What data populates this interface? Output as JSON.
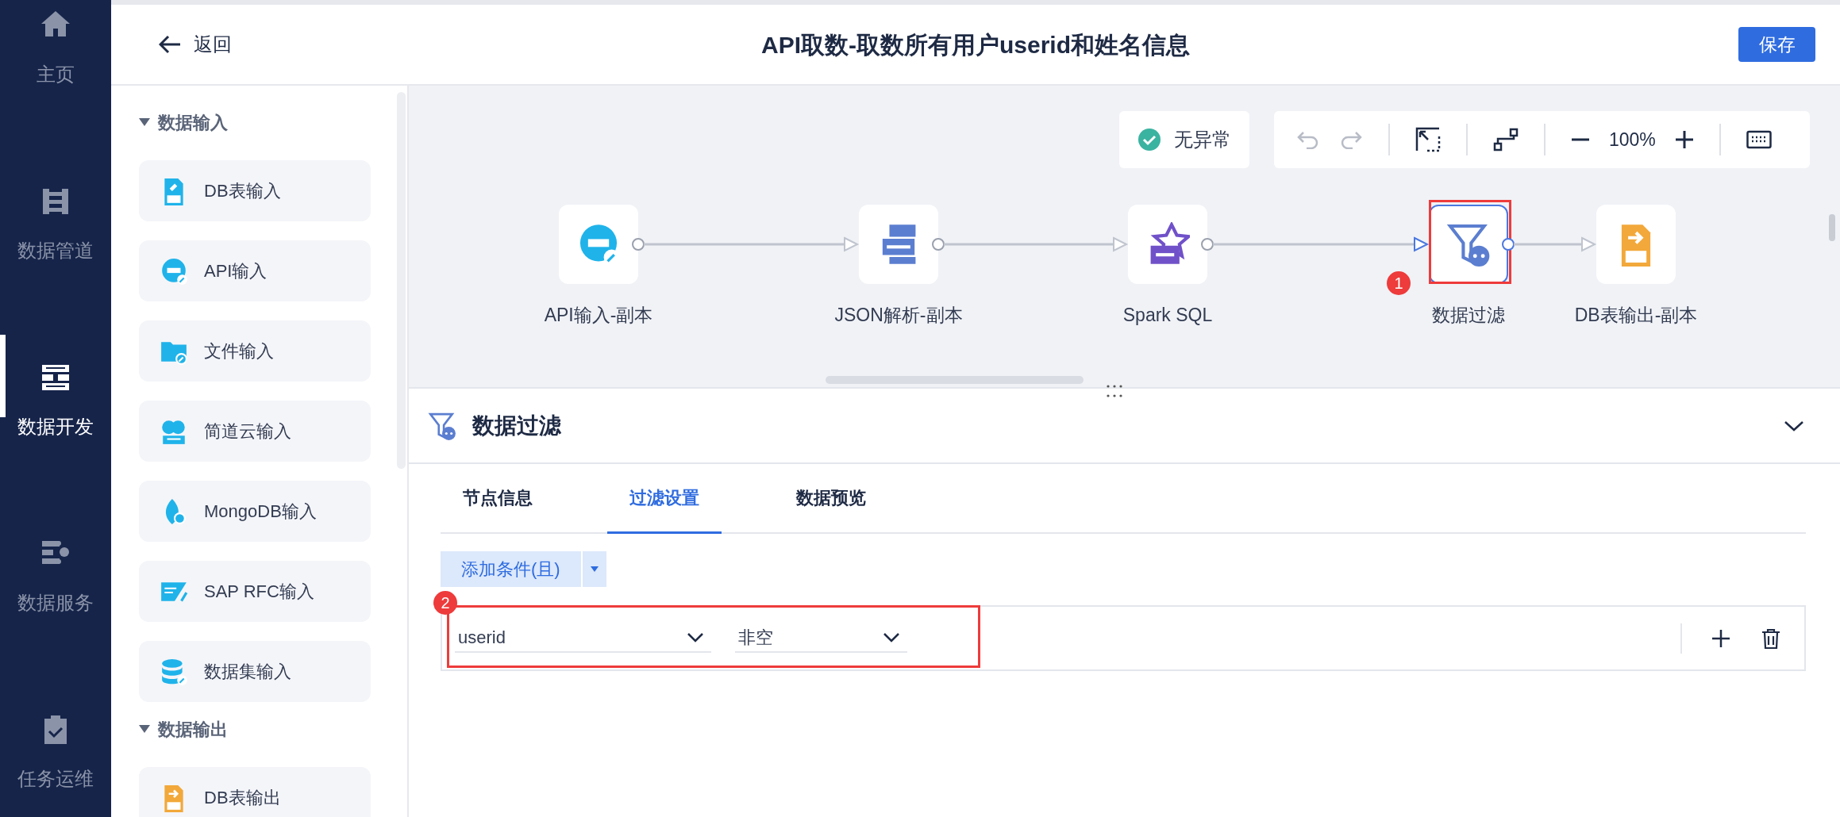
{
  "nav": [
    {
      "label": "主页",
      "kind": "home",
      "selected": false
    },
    {
      "label": "数据管道",
      "kind": "pipeline",
      "selected": false
    },
    {
      "label": "数据开发",
      "kind": "develop",
      "selected": true
    },
    {
      "label": "数据服务",
      "kind": "service",
      "selected": false
    },
    {
      "label": "任务运维",
      "kind": "ops",
      "selected": false
    }
  ],
  "header": {
    "back": "返回",
    "title": "API取数-取数所有用户userid和姓名信息",
    "save": "保存"
  },
  "palette": {
    "sections": [
      {
        "title": "数据输入",
        "expanded": true,
        "items": [
          {
            "label": "DB表输入",
            "kind": "db-in"
          },
          {
            "label": "API输入",
            "kind": "api"
          },
          {
            "label": "文件输入",
            "kind": "file"
          },
          {
            "label": "简道云输入",
            "kind": "jdy"
          },
          {
            "label": "MongoDB输入",
            "kind": "mongo"
          },
          {
            "label": "SAP RFC输入",
            "kind": "sap"
          },
          {
            "label": "数据集输入",
            "kind": "dataset"
          }
        ]
      },
      {
        "title": "数据输出",
        "expanded": true,
        "items": [
          {
            "label": "DB表输出",
            "kind": "db-out"
          }
        ]
      }
    ]
  },
  "canvas": {
    "status": "无异常",
    "zoom": "100%",
    "nodes": [
      {
        "label": "API输入-副本",
        "kind": "api",
        "selected": false
      },
      {
        "label": "JSON解析-副本",
        "kind": "json",
        "selected": false
      },
      {
        "label": "Spark SQL",
        "kind": "sql",
        "selected": false
      },
      {
        "label": "数据过滤",
        "kind": "filter",
        "selected": true,
        "badge": "1"
      },
      {
        "label": "DB表输出-副本",
        "kind": "db-out",
        "selected": false
      }
    ]
  },
  "panel": {
    "title": "数据过滤",
    "expanded": true,
    "tabs": [
      {
        "label": "节点信息",
        "selected": false
      },
      {
        "label": "过滤设置",
        "selected": true
      },
      {
        "label": "数据预览",
        "selected": false
      }
    ],
    "add_button": "添加条件(且)",
    "condition": {
      "field": "userid",
      "operator": "非空",
      "badge": "2"
    }
  }
}
